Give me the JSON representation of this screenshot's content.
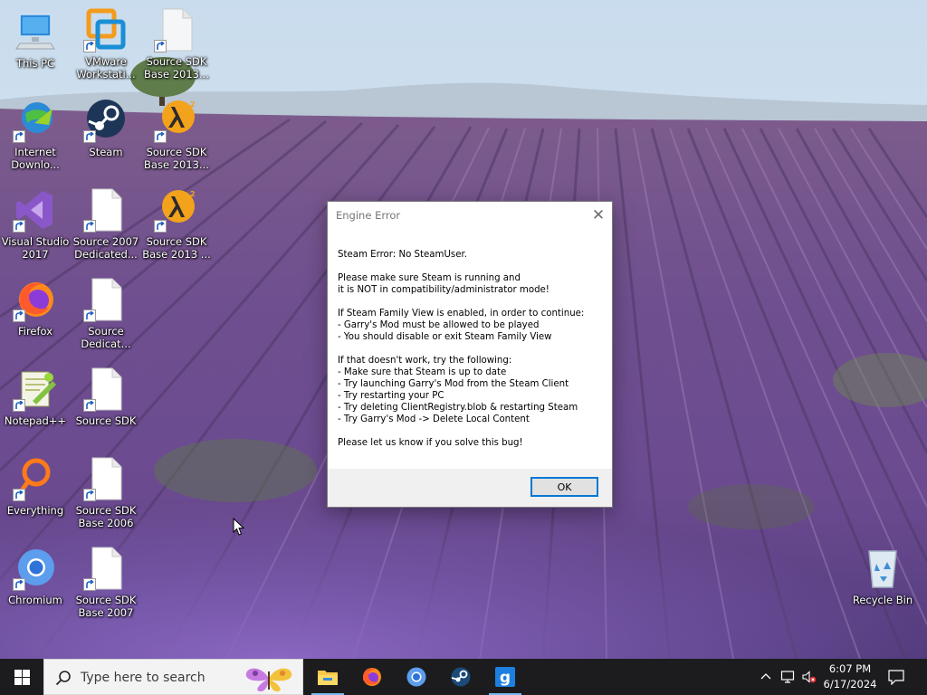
{
  "desktop": {
    "icons": [
      {
        "id": "this-pc",
        "label": "This PC",
        "icon": "computer-icon"
      },
      {
        "id": "vmware",
        "label": "VMware\nWorkstati...",
        "icon": "vmware-icon"
      },
      {
        "id": "sdk2013-top",
        "label": "Source SDK\nBase 2013...",
        "icon": "file-icon"
      },
      {
        "id": "idm",
        "label": "Internet\nDownlo...",
        "icon": "globe-icon"
      },
      {
        "id": "steam",
        "label": "Steam",
        "icon": "steam-icon"
      },
      {
        "id": "sdk2013-hl",
        "label": "Source SDK\nBase 2013...",
        "icon": "half-life-icon"
      },
      {
        "id": "vs2017",
        "label": "Visual Studio\n2017",
        "icon": "visual-studio-icon"
      },
      {
        "id": "sd2007",
        "label": "Source 2007\nDedicated...",
        "icon": "file-icon"
      },
      {
        "id": "sdk2013-hl2",
        "label": "Source SDK\nBase 2013 ...",
        "icon": "half-life-icon"
      },
      {
        "id": "firefox",
        "label": "Firefox",
        "icon": "firefox-icon"
      },
      {
        "id": "source-dedicated",
        "label": "Source\nDedicat...",
        "icon": "file-icon"
      },
      {
        "id": "notepadpp",
        "label": "Notepad++",
        "icon": "notepad-plus-plus-icon"
      },
      {
        "id": "source-sdk",
        "label": "Source SDK",
        "icon": "file-icon"
      },
      {
        "id": "everything",
        "label": "Everything",
        "icon": "everything-search-icon"
      },
      {
        "id": "sdk2006",
        "label": "Source SDK\nBase 2006",
        "icon": "file-icon"
      },
      {
        "id": "chromium",
        "label": "Chromium",
        "icon": "chromium-icon"
      },
      {
        "id": "sdk2007",
        "label": "Source SDK\nBase 2007",
        "icon": "file-icon"
      },
      {
        "id": "recycle-bin",
        "label": "Recycle Bin",
        "icon": "recycle-bin-icon"
      }
    ]
  },
  "dialog": {
    "title": "Engine Error",
    "message": "Steam Error: No SteamUser.\n\nPlease make sure Steam is running and\nit is NOT in compatibility/administrator mode!\n\nIf Steam Family View is enabled, in order to continue:\n- Garry's Mod must be allowed to be played\n- You should disable or exit Steam Family View\n\nIf that doesn't work, try the following:\n- Make sure that Steam is up to date\n- Try launching Garry's Mod from the Steam Client\n- Try restarting your PC\n- Try deleting ClientRegistry.blob & restarting Steam\n- Try Garry's Mod -> Delete Local Content\n\nPlease let us know if you solve this bug!",
    "ok_label": "OK",
    "close_glyph": "✕"
  },
  "taskbar": {
    "search_placeholder": "Type here to search",
    "pinned": [
      "file-explorer-icon",
      "firefox-icon",
      "chromium-icon",
      "steam-icon",
      "garrys-mod-icon"
    ],
    "tray": [
      "chevron-up-icon",
      "network-icon",
      "volume-muted-icon"
    ],
    "clock_time": "6:07 PM",
    "clock_date": "6/17/2024"
  }
}
